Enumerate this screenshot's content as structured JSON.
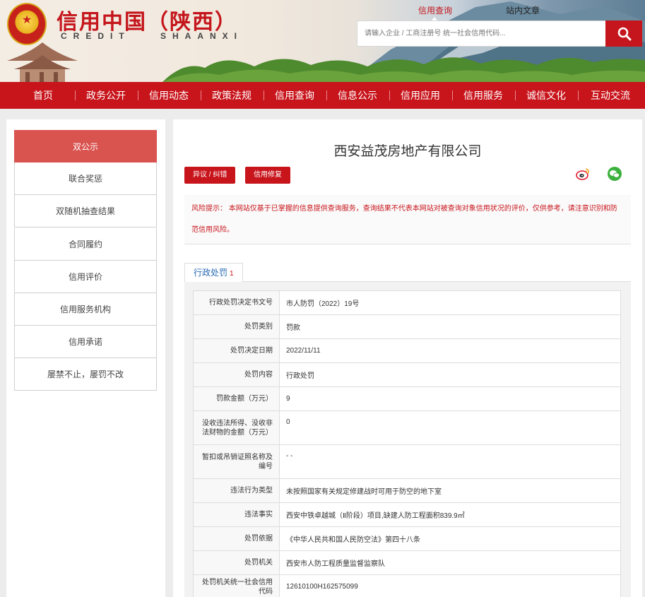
{
  "header": {
    "title": "信用中国（陕西）",
    "subtitle": "CREDIT SHAANXI",
    "top_tabs": [
      "信用查询",
      "站内文章"
    ],
    "search_placeholder": "请输入企业 / 工商注册号 统一社会信用代码...",
    "colors": {
      "brand_red": "#c8141b"
    },
    "icons": [
      "national-emblem-icon",
      "search-icon"
    ]
  },
  "nav": {
    "items": [
      "首页",
      "政务公开",
      "信用动态",
      "政策法规",
      "信用查询",
      "信息公示",
      "信用应用",
      "信用服务",
      "诚信文化",
      "互动交流"
    ]
  },
  "side_menu": {
    "items": [
      "双公示",
      "联合奖惩",
      "双随机抽查结果",
      "合同履约",
      "信用评价",
      "信用服务机构",
      "信用承诺",
      "屡禁不止，屡罚不改"
    ],
    "active_index": 0
  },
  "main": {
    "company_name": "西安益茂房地产有限公司",
    "buttons": [
      "异议 / 纠错",
      "信用修复"
    ],
    "share_icons": [
      "weibo-icon",
      "wechat-icon"
    ],
    "risk_notice": "风险提示： 本网站仅基于已掌握的信息提供查询服务，查询结果不代表本网站对被查询对象信用状况的评价，仅供参考，请注意识别和防范信用风险。",
    "tab": {
      "label": "行政处罚",
      "count": "1"
    },
    "table": [
      {
        "key": "行政处罚决定书文号",
        "value": "市人防罚（2022）19号"
      },
      {
        "key": "处罚类别",
        "value": "罚款"
      },
      {
        "key": "处罚决定日期",
        "value": "2022/11/11"
      },
      {
        "key": "处罚内容",
        "value": "行政处罚"
      },
      {
        "key": "罚款金额（万元）",
        "value": "9"
      },
      {
        "key": "没收违法所得、没收非法财物的金额（万元）",
        "value": "0"
      },
      {
        "key": "暂扣或吊销证照名称及编号",
        "value": "- -"
      },
      {
        "key": "违法行为类型",
        "value": "未按照国家有关规定修建战时可用于防空的地下室"
      },
      {
        "key": "违法事实",
        "value": "西安中铁卓越城（Ⅱ阶段）项目,缺建人防工程面积839.9㎡"
      },
      {
        "key": "处罚依据",
        "value": "《中华人民共和国人民防空法》第四十八条"
      },
      {
        "key": "处罚机关",
        "value": "西安市人防工程质量监督监察队"
      },
      {
        "key": "处罚机关统一社会信用代码",
        "value": "12610100H162575099"
      }
    ]
  }
}
